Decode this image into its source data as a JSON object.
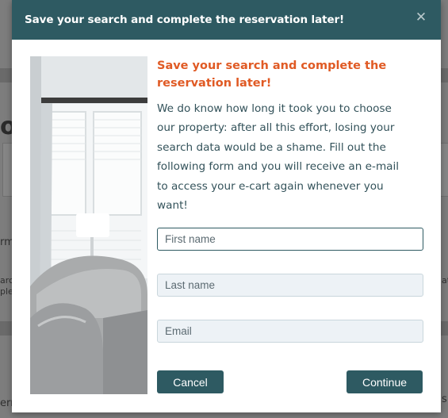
{
  "background": {
    "visible_fragments": [
      "oc",
      "rm",
      "arc",
      "ple",
      "ati",
      "erm",
      "s"
    ]
  },
  "modal": {
    "header_title": "Save your search and complete the reservation later!",
    "close_icon": "close-icon",
    "heading_line1": "Save your search and complete the",
    "heading_line2": "reservation later!",
    "description_lines": [
      "We do know how long it took you to choose",
      "our property: after all this effort, losing your",
      "search data would be a shame. Fill out the",
      "following form and you will receive an e-mail",
      "to access your e-cart again whenever you",
      "want!"
    ],
    "image_icon": "living-room-photo",
    "fields": {
      "first_name_placeholder": "First name",
      "last_name_placeholder": "Last name",
      "email_placeholder": "Email"
    },
    "buttons": {
      "cancel_label": "Cancel",
      "continue_label": "Continue"
    }
  },
  "colors": {
    "header_bg": "#2e5a62",
    "heading_accent": "#e05a24",
    "body_text": "#33525a",
    "button_bg": "#2e5a62",
    "input_bg": "#edf2f6"
  }
}
